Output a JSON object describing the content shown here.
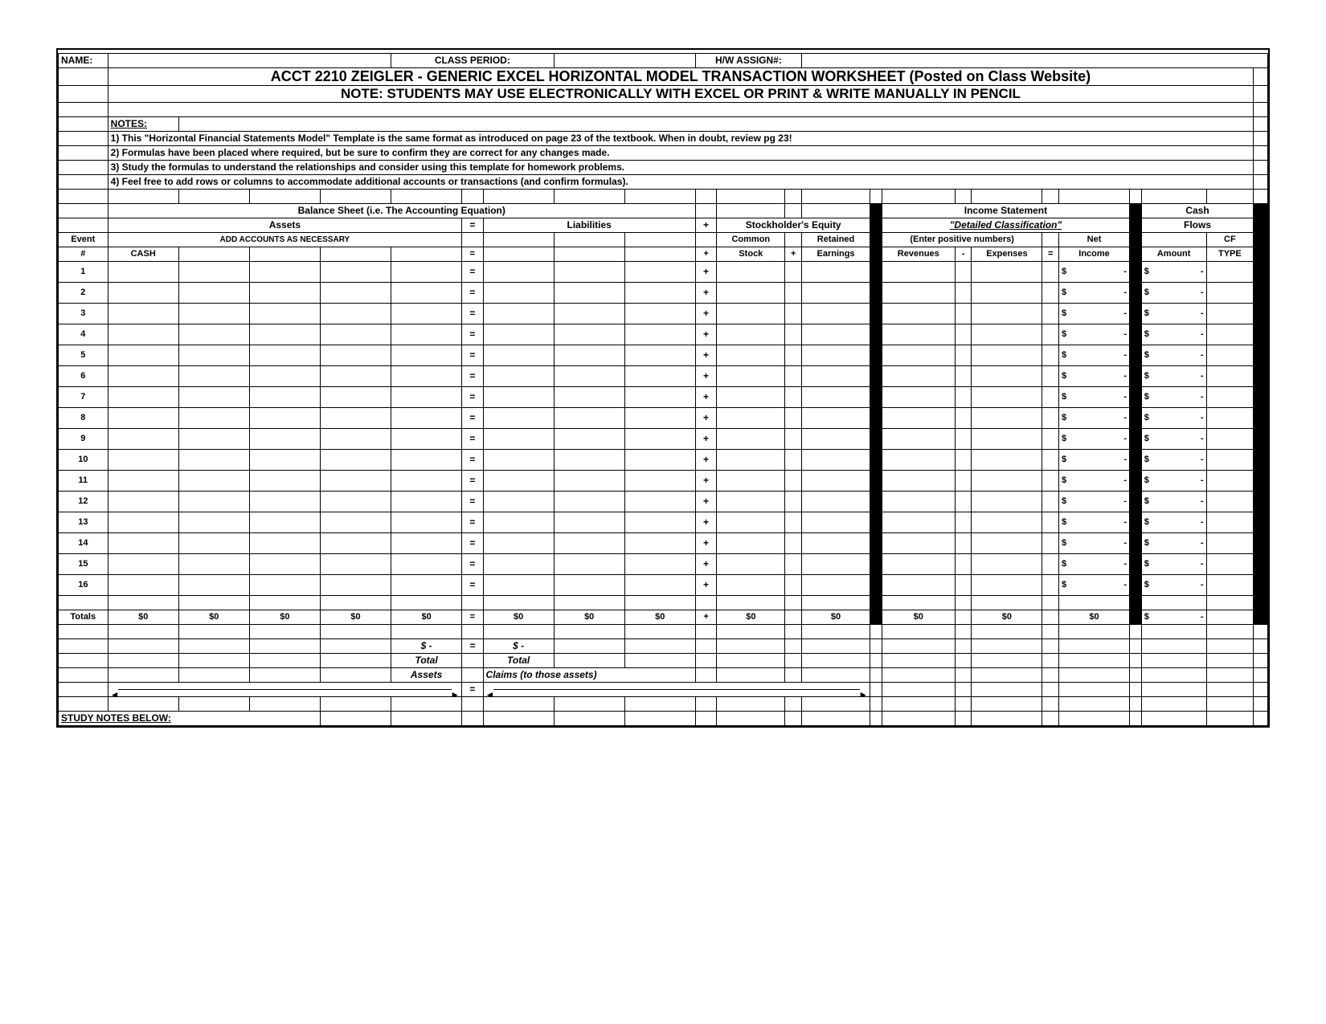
{
  "header": {
    "name_label": "NAME:",
    "class_period_label": "CLASS PERIOD:",
    "hw_assign_label": "H/W ASSIGN#:",
    "title": "ACCT 2210 ZEIGLER - GENERIC EXCEL HORIZONTAL MODEL TRANSACTION WORKSHEET (Posted on Class Website)",
    "subtitle": "NOTE: STUDENTS MAY USE ELECTRONICALLY WITH EXCEL OR PRINT & WRITE MANUALLY IN PENCIL"
  },
  "notes": {
    "heading": "NOTES:",
    "lines": [
      "1) This \"Horizontal Financial Statements Model\" Template is the same format as introduced on page 23 of the textbook. When in doubt, review pg 23!",
      "2) Formulas have been placed where required, but be sure to confirm they are correct for any changes made.",
      "3) Study the formulas to understand the relationships and consider using this template for homework problems.",
      "4) Feel free to add rows or columns to accommodate additional accounts or transactions (and confirm formulas)."
    ]
  },
  "sections": {
    "balance_sheet": "Balance Sheet (i.e. The Accounting Equation)",
    "income_statement": "Income Statement",
    "cash": "Cash",
    "assets": "Assets",
    "liabilities": "Liabilities",
    "stockholders_equity": "Stockholder's Equity",
    "detailed_classification": "\"Detailed Classification\"",
    "flows": "Flows",
    "event": "Event",
    "add_accounts": "ADD ACCOUNTS AS NECESSARY",
    "common": "Common",
    "retained": "Retained",
    "enter_positive": "(Enter positive numbers)",
    "net": "Net",
    "cf": "CF",
    "hash": "#",
    "cash_col": "CASH",
    "stock": "Stock",
    "earnings": "Earnings",
    "revenues": "Revenues",
    "expenses": "Expenses",
    "income": "Income",
    "amount": "Amount",
    "type": "TYPE",
    "eq": "=",
    "plus": "+",
    "minus": "-",
    "totals": "Totals",
    "zero": "$0",
    "dash_dollar": "$          -",
    "total_assets1": "Total",
    "total_assets2": "Assets",
    "total_claims1": "Total",
    "total_claims2": "Claims (to those assets)",
    "study_notes": "STUDY NOTES BELOW:"
  },
  "rows": [
    1,
    2,
    3,
    4,
    5,
    6,
    7,
    8,
    9,
    10,
    11,
    12,
    13,
    14,
    15,
    16
  ],
  "row_dollar": "$",
  "row_dash": "-"
}
